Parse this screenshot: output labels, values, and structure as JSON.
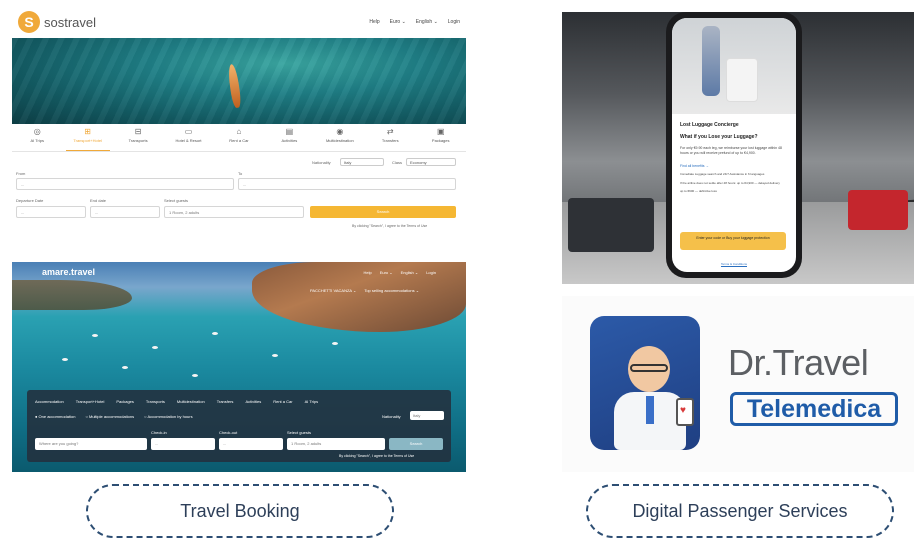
{
  "sostravel": {
    "logo": "sostravel",
    "nav": {
      "help": "Help",
      "currency": "Euro ⌄",
      "language": "English ⌄",
      "login": "Login"
    },
    "tabs": [
      {
        "label": "AI Trips",
        "icon": "ai-icon"
      },
      {
        "label": "Transport+Hotel",
        "icon": "train-icon",
        "active": true
      },
      {
        "label": "Transports",
        "icon": "bus-icon"
      },
      {
        "label": "Hotel & Resort",
        "icon": "bed-icon"
      },
      {
        "label": "Rent a Car",
        "icon": "car-icon"
      },
      {
        "label": "Activities",
        "icon": "ticket-icon"
      },
      {
        "label": "Multidestination",
        "icon": "pin-icon"
      },
      {
        "label": "Transfers",
        "icon": "swap-icon"
      },
      {
        "label": "Packages",
        "icon": "bag-icon"
      }
    ],
    "nationality_label": "Nationality",
    "nationality_value": "Italy",
    "class_label": "Class",
    "class_value": "Economy",
    "from_label": "From",
    "to_label": "To",
    "from_value": "...",
    "to_value": "...",
    "departure_label": "Departure Date",
    "end_label": "End date",
    "guests_label": "Select guests",
    "departure_value": "...",
    "end_value": "...",
    "guests_value": "1 Room, 2 adults",
    "search": "Search",
    "terms": "By clicking \"Search\", I agree to the Terms of Use"
  },
  "amare": {
    "logo": "amare.travel",
    "nav": {
      "help": "Help",
      "euro": "Euro ⌄",
      "language": "English ⌄",
      "login": "Login"
    },
    "sub": {
      "packages": "PACCHETTI VACANZA ⌄",
      "top": "Top selling accommodations ⌄"
    },
    "tabs": [
      "Accommodation",
      "Transport+Hotel",
      "Packages",
      "Transports",
      "Multidestination",
      "Transfers",
      "Activities",
      "Rent a Car",
      "AI Trips"
    ],
    "options": [
      "One accommodation",
      "Multiple accommodations",
      "Accommodation by hours"
    ],
    "nationality_label": "Nationality",
    "nationality_value": "Italy",
    "where_placeholder": "Where are you going?",
    "checkin_label": "Check-in",
    "checkout_label": "Check-out",
    "guests_label": "Select guests",
    "checkin_value": "...",
    "checkout_value": "...",
    "guests_value": "1 Room, 2 adults",
    "search": "Search",
    "terms": "By clicking \"Search\", I agree to the Terms of Use"
  },
  "phone": {
    "title": "Lost Luggage Concierge",
    "subtitle": "What if you Lose your Luggage?",
    "body": "For only €9.90 each leg, we reimburse your lost luggage within 48 hours or you will receive prefund of up to €4,900.",
    "link": "Find all benefits →",
    "list": [
      "Immediate Luggage search and 24/7 Assistance in 6 languages",
      "If the airline does not settle after 48 hours: up to €4,900 — delayed delivery",
      "up to €900 — definitive loss"
    ],
    "cta": "Enter your code or Buy your luggage protection",
    "tc": "Terms & Conditions"
  },
  "drtravel": {
    "name": "Dr.Travel",
    "sub": "Telemedica"
  },
  "captions": {
    "left": "Travel Booking",
    "right": "Digital Passenger Services"
  }
}
